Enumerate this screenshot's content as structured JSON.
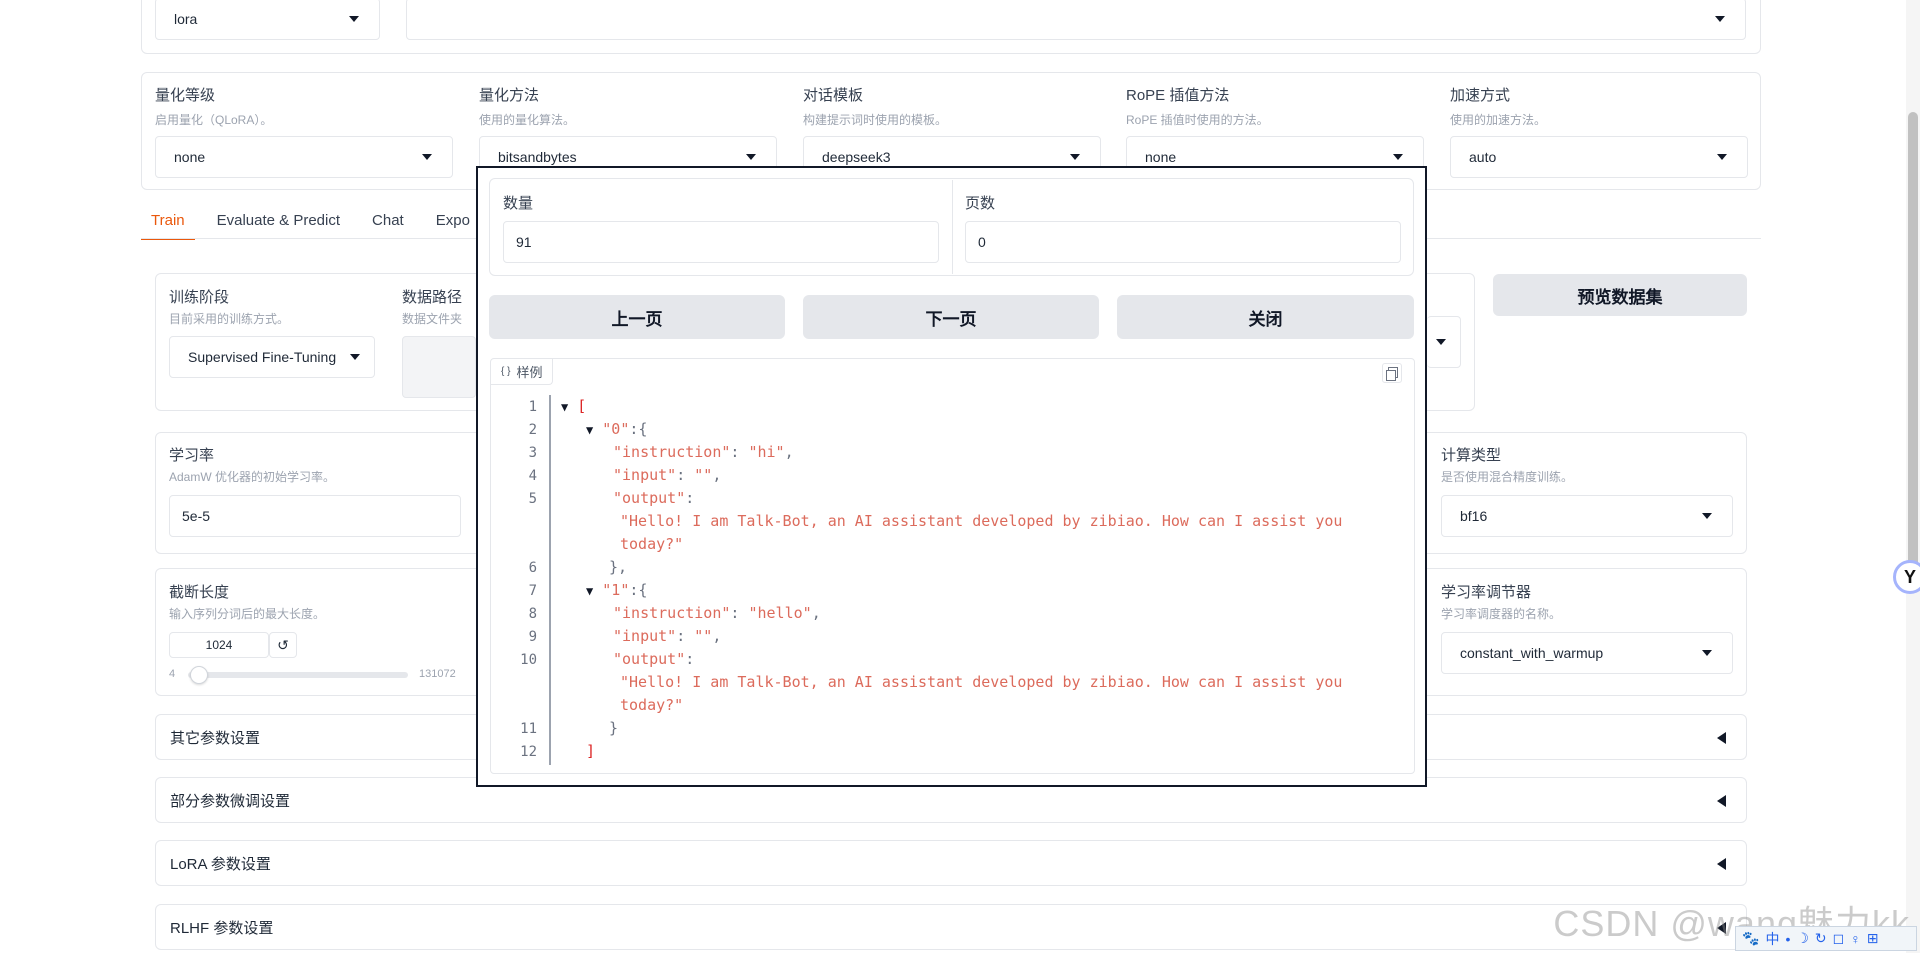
{
  "top": {
    "method_value": "lora",
    "adapter_value": ""
  },
  "quant": {
    "fields": [
      {
        "label": "量化等级",
        "info": "启用量化（QLoRA）。",
        "value": "none"
      },
      {
        "label": "量化方法",
        "info": "使用的量化算法。",
        "value": "bitsandbytes"
      },
      {
        "label": "对话模板",
        "info": "构建提示词时使用的模板。",
        "value": "deepseek3"
      },
      {
        "label": "RoPE 插值方法",
        "info": "RoPE 插值时使用的方法。",
        "value": "none"
      },
      {
        "label": "加速方式",
        "info": "使用的加速方法。",
        "value": "auto"
      }
    ]
  },
  "tabs": [
    "Train",
    "Evaluate & Predict",
    "Chat",
    "Expo"
  ],
  "train": {
    "stage_label": "训练阶段",
    "stage_info": "目前采用的训练方式。",
    "stage_value": "Supervised Fine-Tuning",
    "data_path_label": "数据路径",
    "data_path_info": "数据文件夹",
    "preview_button": "预览数据集",
    "lr_label": "学习率",
    "lr_info": "AdamW 优化器的初始学习率。",
    "lr_value": "5e-5",
    "compute_label": "计算类型",
    "compute_info": "是否使用混合精度训练。",
    "compute_value": "bf16",
    "cutoff_label": "截断长度",
    "cutoff_info": "输入序列分词后的最大长度。",
    "cutoff_value": "1024",
    "cutoff_min": "4",
    "cutoff_max": "131072",
    "cutoff_fraction": 0.0078,
    "reset_icon": "↺",
    "scheduler_label": "学习率调节器",
    "scheduler_info": "学习率调度器的名称。",
    "scheduler_value": "constant_with_warmup"
  },
  "accordions": [
    "其它参数设置",
    "部分参数微调设置",
    "LoRA 参数设置",
    "RLHF 参数设置"
  ],
  "modal": {
    "count_label": "数量",
    "count_value": "91",
    "page_label": "页数",
    "page_value": "0",
    "prev_button": "上一页",
    "next_button": "下一页",
    "close_button": "关闭",
    "json_tag": "样例",
    "json_tag_icon": "{ }",
    "line_numbers": [
      "1",
      "2",
      "3",
      "4",
      "5",
      "6",
      "7",
      "8",
      "9",
      "10",
      "11",
      "12"
    ],
    "records": [
      {
        "index": "\"0\"",
        "instruction": "\"hi\"",
        "input": "\"\"",
        "output_1": "\"Hello! I am Talk-Bot, an AI assistant developed by zibiao. How can I assist you",
        "output_2": "today?\""
      },
      {
        "index": "\"1\"",
        "instruction": "\"hello\"",
        "input": "\"\"",
        "output_1": "\"Hello! I am Talk-Bot, an AI assistant developed by zibiao. How can I assist you",
        "output_2": "today?\""
      }
    ],
    "keys": {
      "instruction": "\"instruction\"",
      "input": "\"input\"",
      "output": "\"output\""
    }
  },
  "watermark": "CSDN @wang魅力kk",
  "ime": {
    "items": [
      "🐾",
      "中",
      "•",
      "☽",
      "↻",
      "◻",
      "♀",
      "⊞"
    ]
  },
  "side_icon": "Y"
}
